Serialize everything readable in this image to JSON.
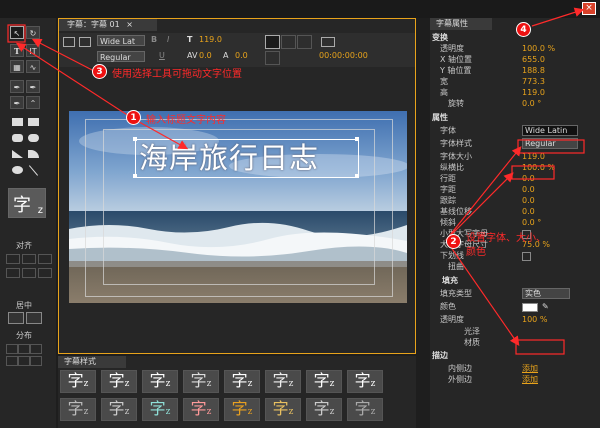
{
  "editor": {
    "tab_title": "字幕：字幕 01",
    "font_name": "Wide Lat",
    "font_style": "Regular",
    "size": "119.0",
    "kern": "0.0",
    "lead": "0.0",
    "timecode": "00:00:00:00",
    "title_text": "海岸旅行日志",
    "caption_glyph": "字"
  },
  "tools": {
    "caption_glyph": "字",
    "align_label": "对齐",
    "center_label": "居中",
    "distribute_label": "分布"
  },
  "styles": {
    "title": "字幕样式",
    "glyph": "字",
    "tiles": [
      {
        "color": "#ffffff"
      },
      {
        "color": "#ffffff"
      },
      {
        "color": "#ffffff"
      },
      {
        "color": "#dddddd"
      },
      {
        "color": "#ffffff"
      },
      {
        "color": "#eeeeee"
      },
      {
        "color": "#ffffff"
      },
      {
        "color": "#ffffff"
      },
      {
        "color": "#bbbbbb"
      },
      {
        "color": "#cccccc"
      },
      {
        "color": "#8fe0d8"
      },
      {
        "color": "#ff9999"
      },
      {
        "color": "#e8a020"
      },
      {
        "color": "#e8c060"
      },
      {
        "color": "#cccccc"
      },
      {
        "color": "#aaaaaa"
      }
    ]
  },
  "properties": {
    "title": "字幕属性",
    "transform_label": "变换",
    "opacity_label": "透明度",
    "opacity": "100.0 %",
    "x_label": "X 轴位置",
    "x": "655.0",
    "y_label": "Y 轴位置",
    "y": "188.8",
    "width_label": "宽",
    "width": "773.3",
    "height_label": "高",
    "height": "119.0",
    "rotate_label": "旋转",
    "rotate": "0.0 °",
    "attr_label": "属性",
    "font_label": "字体",
    "font": "Wide Latin",
    "fstyle_label": "字体样式",
    "fstyle": "Regular",
    "fsize_label": "字体大小",
    "fsize": "119.0",
    "aspect_label": "纵横比",
    "aspect": "100.0 %",
    "leading_label": "行距",
    "leading": "0.0",
    "kerning_label": "字距",
    "kerning": "0.0",
    "tracking_label": "跟踪",
    "tracking": "0.0",
    "baseline_label": "基线位移",
    "baseline": "0.0",
    "slant_label": "倾斜",
    "slant": "0.0 °",
    "smallcaps_label": "小型大写字母",
    "smallcaps_size_label": "大写字母尺寸",
    "smallcaps_size": "75.0 %",
    "underline_label": "下划线",
    "distort_label": "扭曲",
    "fill_label": "填充",
    "filltype_label": "填充类型",
    "filltype": "实色",
    "color_label": "颜色",
    "fill_opacity_label": "透明度",
    "fill_opacity": "100 %",
    "sheen_label": "光泽",
    "texture_label": "材质",
    "stroke_label": "描边",
    "inner_label": "内侧边",
    "add_label": "添加",
    "outer_label": "外侧边",
    "add2_label": "添加"
  },
  "annotations": {
    "note1": "输入标题文字内容",
    "note2_line1": "设置字体、大小、",
    "note2_line2": "颜色",
    "note3": "使用选择工具可拖动文字位置",
    "b1": "1",
    "b2": "2",
    "b3": "3",
    "b4": "4"
  },
  "colors": {
    "accent": "#e8a31b",
    "annotation": "#ff2a2a",
    "fill_color": "#ffffff"
  }
}
